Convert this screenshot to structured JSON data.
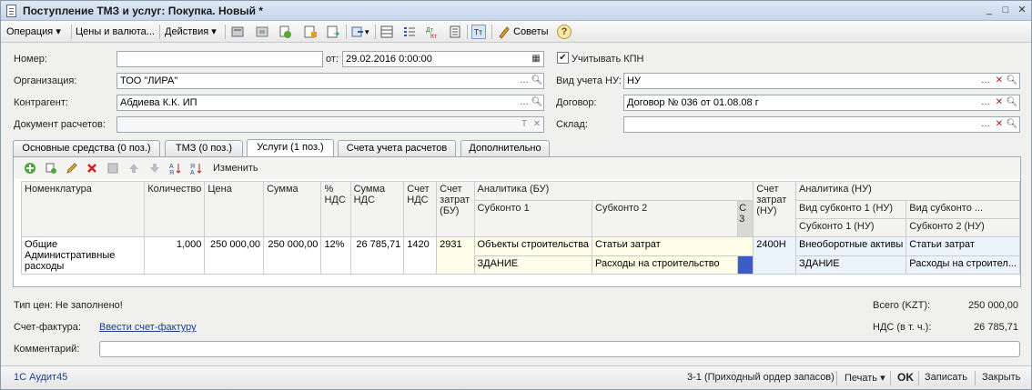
{
  "window": {
    "title": "Поступление ТМЗ и услуг: Покупка. Новый *",
    "btn_min": "_",
    "btn_max": "□",
    "btn_close": "✕"
  },
  "toolbar": {
    "operation": "Операция",
    "prices": "Цены и валюта...",
    "actions": "Действия",
    "tips": "Советы",
    "help": "?"
  },
  "form": {
    "number_label": "Номер:",
    "number_value": "",
    "date_label": "от:",
    "date_value": "29.02.2016  0:00:00",
    "kpn_label": "Учитывать КПН",
    "kpn_checked": "✔",
    "org_label": "Организация:",
    "org_value": "ТОО \"ЛИРА\"",
    "nu_label": "Вид учета НУ:",
    "nu_value": "НУ",
    "contractor_label": "Контрагент:",
    "contractor_value": "Абдиева К.К. ИП",
    "contract_label": "Договор:",
    "contract_value": "Договор № 036 от 01.08.08 г",
    "doc_label": "Документ расчетов:",
    "doc_value": "",
    "warehouse_label": "Склад:",
    "warehouse_value": ""
  },
  "tabs": [
    {
      "label": "Основные средства (0 поз.)"
    },
    {
      "label": "ТМЗ (0 поз.)"
    },
    {
      "label": "Услуги (1 поз.)"
    },
    {
      "label": "Счета учета расчетов"
    },
    {
      "label": "Дополнительно"
    }
  ],
  "grid_toolbar": {
    "edit": "Изменить"
  },
  "grid": {
    "headers": {
      "nomenclature": "Номенклатура",
      "qty": "Количество",
      "price": "Цена",
      "sum": "Сумма",
      "vat_pct": "% НДС",
      "vat_sum": "Сумма НДС",
      "vat_acc": "Счет НДС",
      "cost_acc": "Счет затрат (БУ)",
      "analytics_bu": "Аналитика (БУ)",
      "subkonto1": "Субконто 1",
      "subkonto2": "Субконто 2",
      "subkonto3": "С 3",
      "cost_acc_nu": "Счет затрат (НУ)",
      "analytics_nu": "Аналитика (НУ)",
      "vid_sub1_nu": "Вид субконто 1 (НУ)",
      "vid_sub_nu": "Вид субконто ...",
      "sub1_nu": "Субконто 1 (НУ)",
      "sub2_nu": "Субконто 2 (НУ)"
    },
    "row": {
      "nomenclature": "Общие Административные расходы",
      "qty": "1,000",
      "price": "250 000,00",
      "sum": "250 000,00",
      "vat_pct": "12%",
      "vat_sum": "26 785,71",
      "vat_acc": "1420",
      "cost_acc": "2931",
      "sub1_top": "Объекты строительства",
      "sub2_top": "Статьи затрат",
      "sub1_bottom": "ЗДАНИЕ",
      "sub2_bottom": "Расходы на строительство",
      "cost_acc_nu": "2400Н",
      "vid1_nu": "Внеоборотные активы",
      "vid2_nu": "Статьи затрат",
      "sub1_nu": "ЗДАНИЕ",
      "sub2_nu": "Расходы на строител..."
    }
  },
  "footer": {
    "price_type": "Тип цен: Не заполнено!",
    "total_label": "Всего (KZT):",
    "total_value": "250 000,00",
    "invoice_label": "Счет-фактура:",
    "invoice_link": "Ввести счет-фактуру",
    "vat_label": "НДС (в т. ч.):",
    "vat_value": "26 785,71",
    "comment_label": "Комментарий:",
    "comment_value": ""
  },
  "statusbar": {
    "app": "1С Аудит45",
    "order": "3-1 (Приходный ордер запасов)",
    "print": "Печать",
    "ok": "OK",
    "save": "Записать",
    "close": "Закрыть"
  }
}
